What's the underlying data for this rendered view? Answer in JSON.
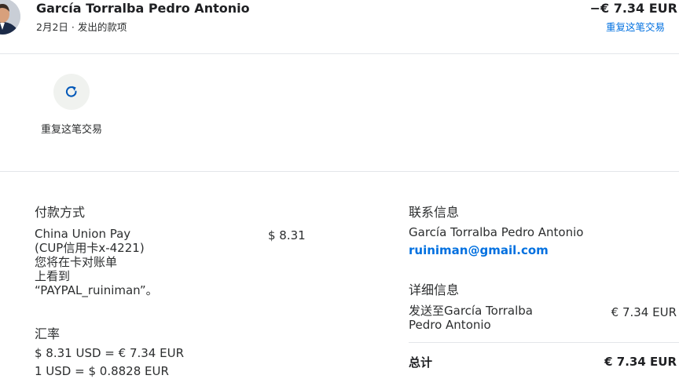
{
  "header": {
    "name": "García Torralba Pedro Antonio",
    "subline": "2月2日 · 发出的款项",
    "amount": "−€ 7.34 EUR",
    "repeat_link": "重复这笔交易"
  },
  "actions": {
    "repeat_label": "重复这笔交易",
    "repeat_icon": "refresh-icon"
  },
  "payment_method": {
    "title": "付款方式",
    "lines": [
      "China Union Pay",
      "(CUP信用卡x-4221)",
      "您将在卡对账单",
      "上看到",
      "“PAYPAL_ruiniman”。"
    ],
    "amount": "$ 8.31"
  },
  "exchange_rate": {
    "title": "汇率",
    "line1": "$ 8.31 USD = € 7.34 EUR",
    "line2": "1 USD = $ 0.8828 EUR"
  },
  "contact": {
    "title": "联系信息",
    "name": "García Torralba Pedro Antonio",
    "email": "ruiniman@gmail.com"
  },
  "details": {
    "title": "详细信息",
    "sent_to_lines": [
      "发送至García Torralba",
      "Pedro Antonio"
    ],
    "sent_amount": "€ 7.34 EUR",
    "total_label": "总计",
    "total_amount": "€ 7.34 EUR"
  },
  "colors": {
    "link": "#0070e0",
    "text": "#2c2e2f",
    "icon": "#0057b8",
    "action_bg": "#f0f2ef",
    "divider": "#e3e6ea"
  }
}
